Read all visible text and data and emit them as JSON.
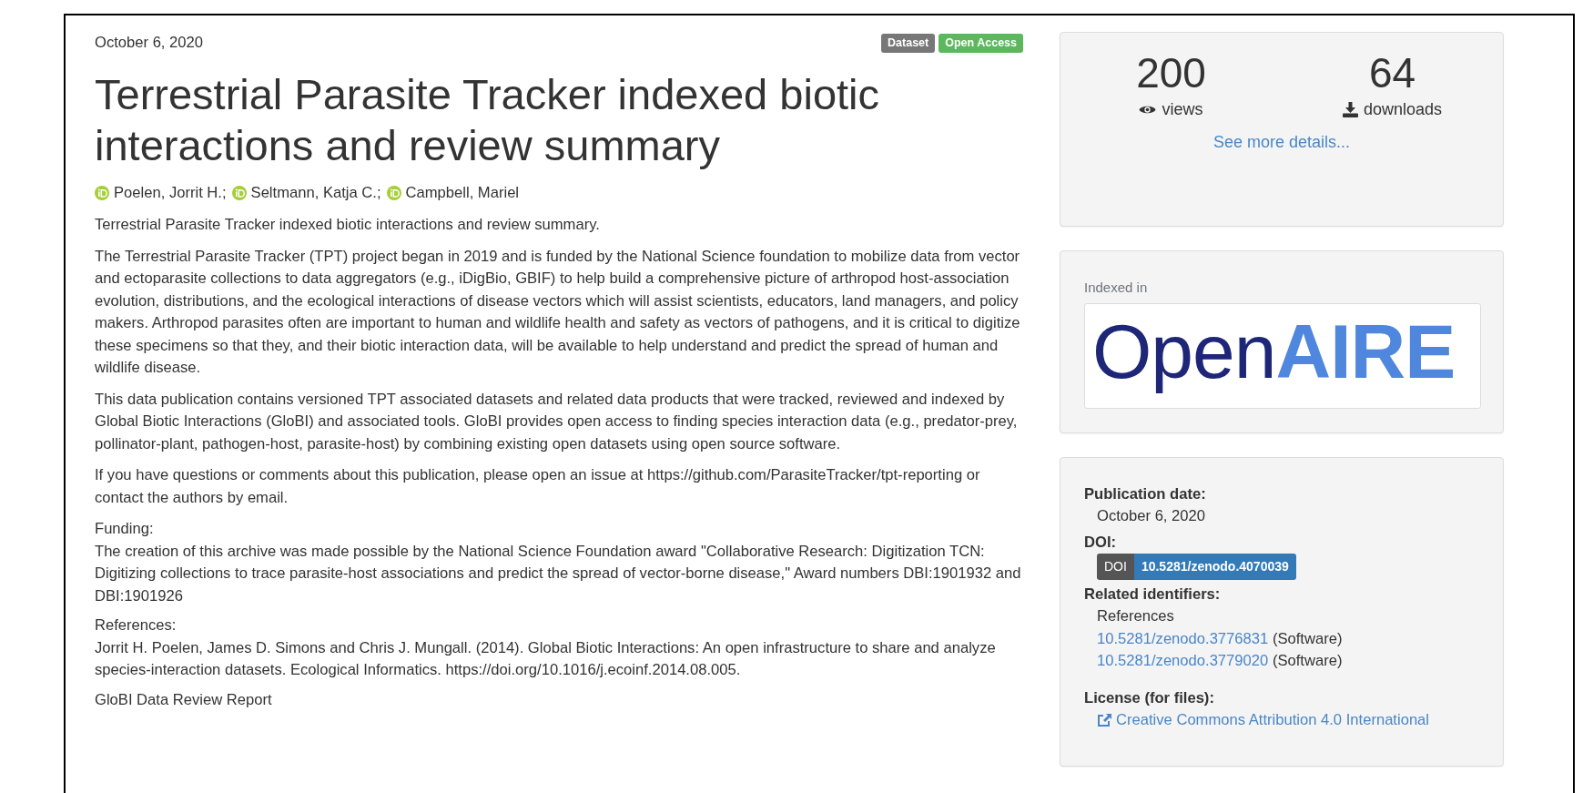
{
  "header": {
    "date": "October 6, 2020",
    "badges": [
      {
        "label": "Dataset",
        "color": "#777777"
      },
      {
        "label": "Open Access",
        "color": "#5cb85c"
      }
    ]
  },
  "title": "Terrestrial Parasite Tracker indexed biotic interactions and review summary",
  "authors": [
    "Poelen, Jorrit H.;",
    "Seltmann, Katja C.;",
    "Campbell, Mariel"
  ],
  "description": [
    {
      "kind": "paragraph",
      "text": "Terrestrial Parasite Tracker indexed biotic interactions and review summary."
    },
    {
      "kind": "paragraph",
      "text": "The Terrestrial Parasite Tracker (TPT) project began in 2019 and is funded by the National Science foundation to mobilize data from vector and ectoparasite collections to data aggregators (e.g., iDigBio, GBIF) to help build a comprehensive picture of arthropod host-association evolution, distributions, and the ecological interactions of disease vectors which will assist scientists, educators, land managers, and policy makers. Arthropod parasites often are important to human and wildlife health and safety as vectors of pathogens, and it is critical to digitize these specimens so that they, and their biotic interaction data, will be available to help understand and predict the spread of human and wildlife disease."
    },
    {
      "kind": "paragraph",
      "text": "This data publication contains versioned TPT associated datasets and related data products that were tracked, reviewed and indexed by Global Biotic Interactions (GloBI) and associated tools. GloBI provides open access to finding species interaction data (e.g., predator-prey, pollinator-plant, pathogen-host, parasite-host) by combining existing open datasets using open source software."
    },
    {
      "kind": "paragraph",
      "text": "If you have questions or comments about this publication, please open an issue at https://github.com/ParasiteTracker/tpt-reporting or contact the authors by email."
    },
    {
      "kind": "section",
      "heading": "Funding:",
      "text": "The creation of this archive was made possible by the National Science Foundation award \"Collaborative Research: Digitization TCN: Digitizing collections to trace parasite-host associations and predict the spread of vector-borne disease,\" Award numbers DBI:1901932 and DBI:1901926"
    },
    {
      "kind": "section",
      "heading": "References:",
      "text": "Jorrit H. Poelen, James D. Simons and Chris J. Mungall. (2014). Global Biotic Interactions: An open infrastructure to share and analyze species-interaction datasets. Ecological Informatics. https://doi.org/10.1016/j.ecoinf.2014.08.005."
    },
    {
      "kind": "section",
      "heading": "GloBI Data Review Report"
    }
  ],
  "stats": {
    "items": [
      {
        "kind": "views",
        "value": "200",
        "label": "views"
      },
      {
        "kind": "downloads",
        "value": "64",
        "label": "downloads"
      }
    ],
    "link": "See more details..."
  },
  "indexed": {
    "label": "Indexed in",
    "logo": [
      "Open",
      "AIRE"
    ]
  },
  "details": {
    "publication_date": {
      "label": "Publication date:",
      "value": "October 6, 2020"
    },
    "doi": {
      "label": "DOI:",
      "badge_key": "DOI",
      "badge_value": "10.5281/zenodo.4070039"
    },
    "related": {
      "label": "Related identifiers:",
      "relation": "References",
      "items": [
        {
          "id": "10.5281/zenodo.3776831",
          "type": "(Software)"
        },
        {
          "id": "10.5281/zenodo.3779020",
          "type": "(Software)"
        }
      ]
    },
    "license": {
      "label": "License (for files):",
      "link": "Creative Commons Attribution 4.0 International"
    }
  }
}
